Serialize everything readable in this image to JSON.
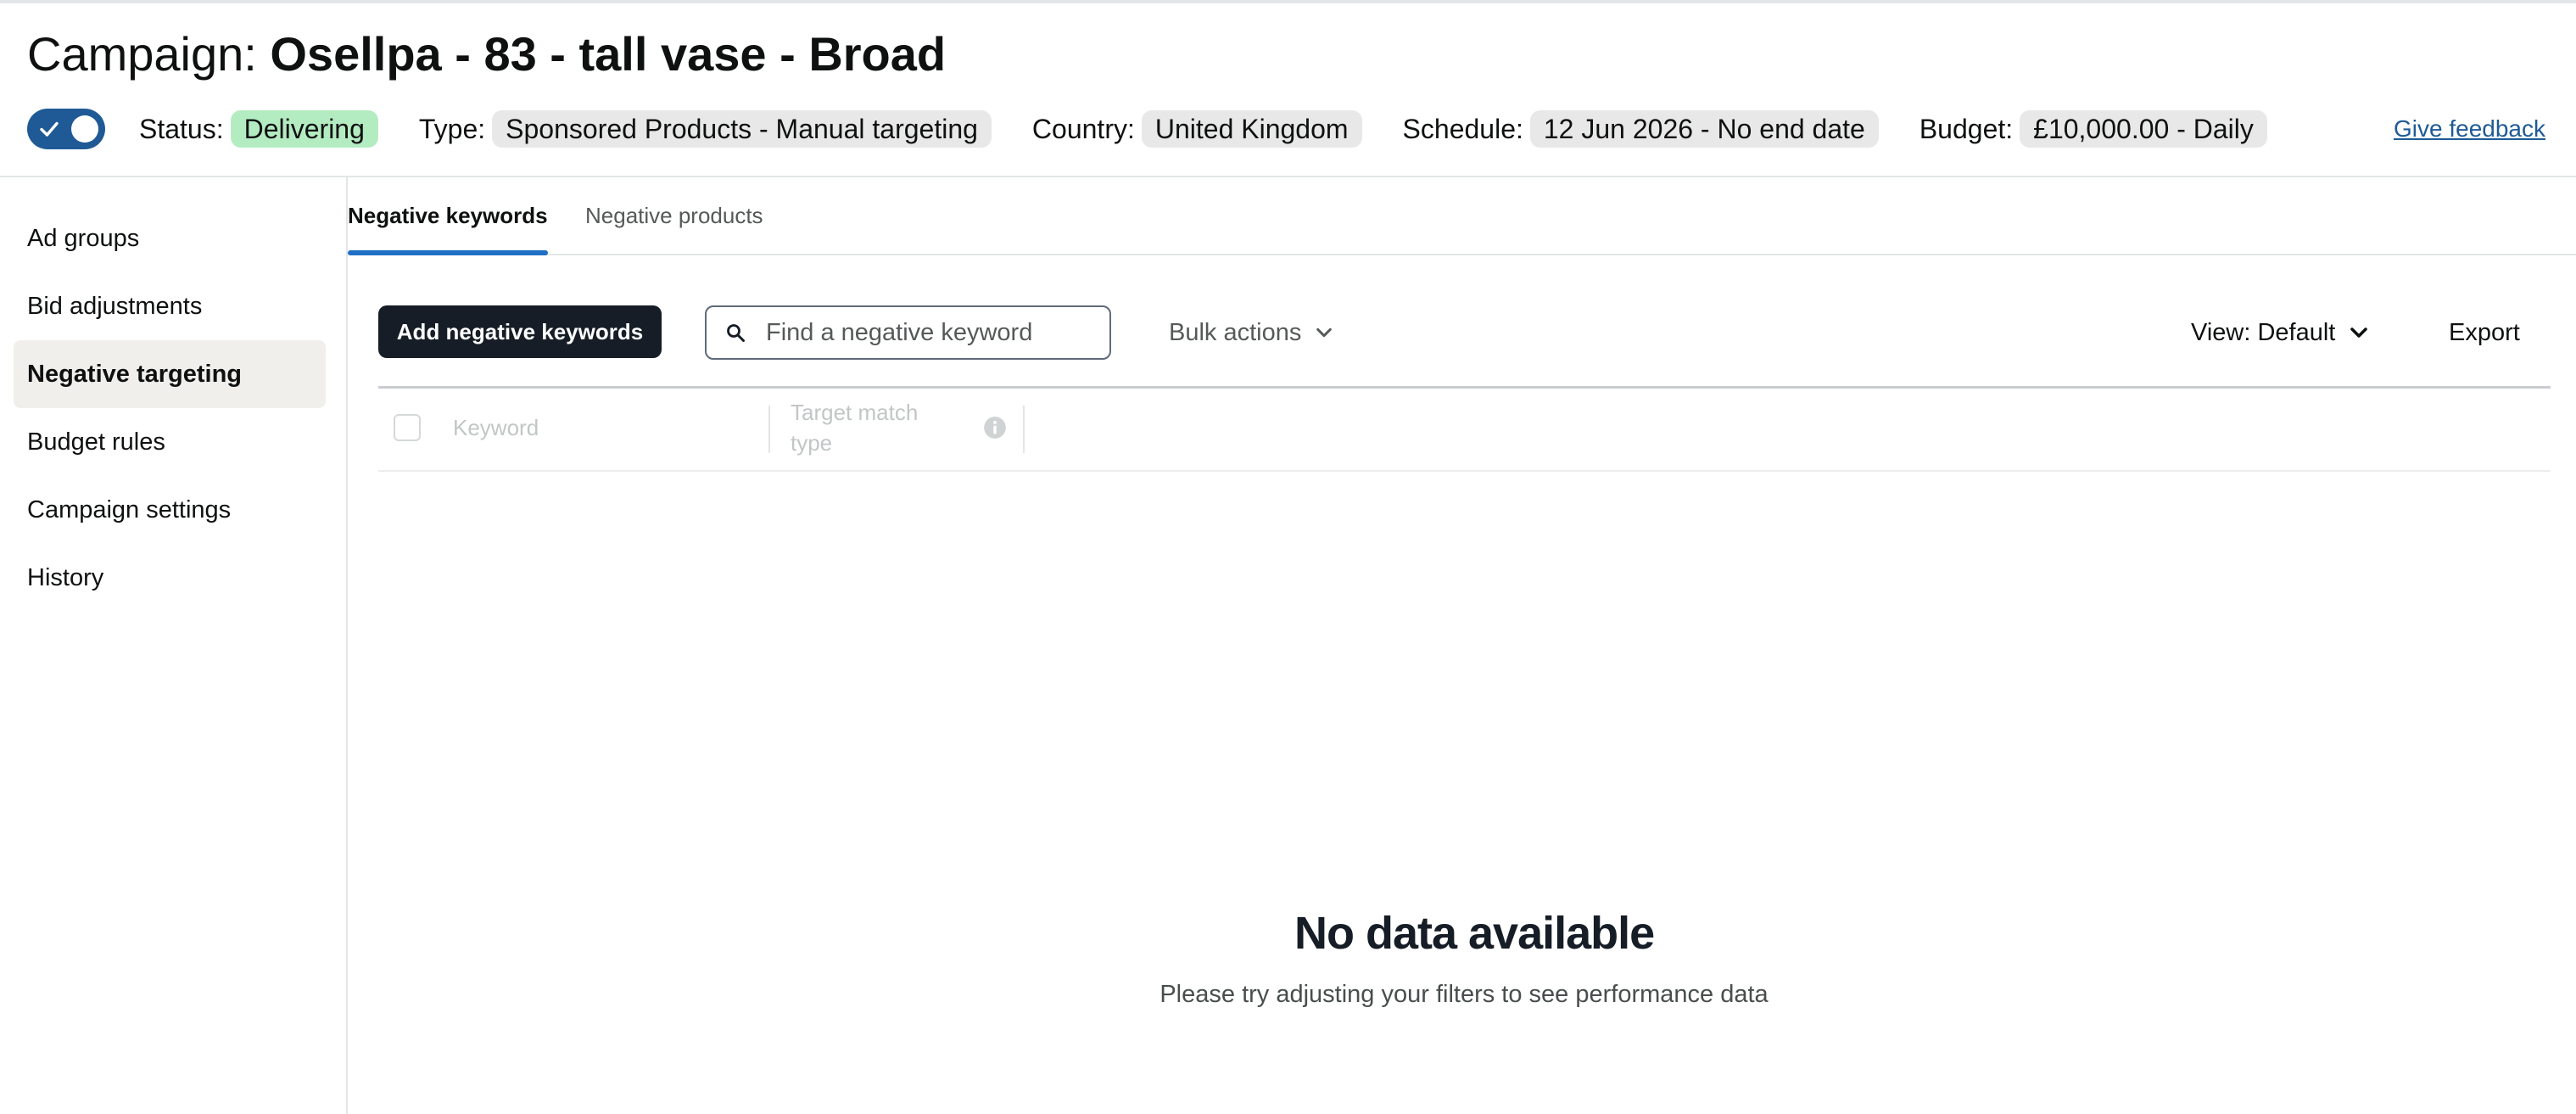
{
  "header": {
    "title_prefix": "Campaign:",
    "campaign_name": "Osellpa - 83 - tall vase - Broad",
    "toggle_on": true,
    "status_label": "Status:",
    "status_value": "Delivering",
    "type_label": "Type:",
    "type_value": "Sponsored Products - Manual targeting",
    "country_label": "Country:",
    "country_value": "United Kingdom",
    "schedule_label": "Schedule:",
    "schedule_value": "12 Jun 2026 - No end date",
    "budget_label": "Budget:",
    "budget_value": "£10,000.00 - Daily",
    "feedback_link": "Give feedback"
  },
  "sidebar": {
    "items": [
      {
        "label": "Ad groups",
        "active": false
      },
      {
        "label": "Bid adjustments",
        "active": false
      },
      {
        "label": "Negative targeting",
        "active": true
      },
      {
        "label": "Budget rules",
        "active": false
      },
      {
        "label": "Campaign settings",
        "active": false
      },
      {
        "label": "History",
        "active": false
      }
    ]
  },
  "tabs": [
    {
      "label": "Negative keywords",
      "active": true
    },
    {
      "label": "Negative products",
      "active": false
    }
  ],
  "toolbar": {
    "add_button": "Add negative keywords",
    "search_placeholder": "Find a negative keyword",
    "search_value": "",
    "bulk_actions": "Bulk actions",
    "view_label": "View: Default",
    "export": "Export"
  },
  "table": {
    "columns": [
      "Keyword",
      "Target match type"
    ],
    "rows": []
  },
  "empty_state": {
    "title": "No data available",
    "subtitle": "Please try adjusting your filters to see performance data"
  },
  "colors": {
    "toggle": "#1f5a96",
    "status_pill": "#b4ecc2",
    "primary_button": "#161d26",
    "active_tab_underline": "#1f6fc5",
    "link": "#1f5a96"
  },
  "icons": {
    "toggle": "check-icon",
    "search": "search-icon",
    "bulk_actions": "chevron-down-icon",
    "view": "chevron-down-icon",
    "column_info": "info-icon"
  }
}
